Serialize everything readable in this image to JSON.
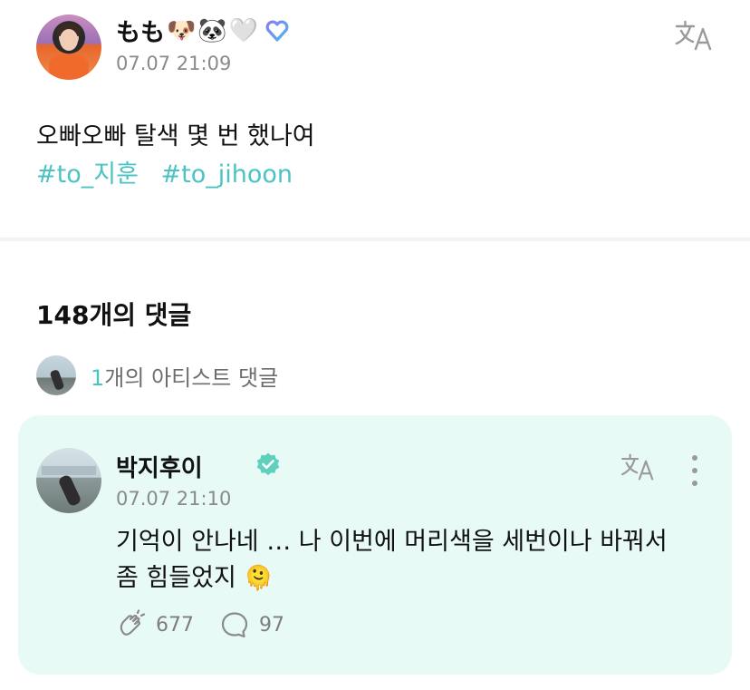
{
  "post": {
    "author_name": "もも",
    "author_emojis": [
      "🐶",
      "🐼",
      "🤍"
    ],
    "timestamp": "07.07 21:09",
    "body": "오빠오빠 탈색 몇 번 했나여",
    "hashtags": [
      "#to_지훈",
      "#to_jihoon"
    ],
    "translate_icon": "translate-icon",
    "badge_icon": "weverse-heart-icon"
  },
  "comments_section": {
    "count_label": "148개의 댓글",
    "artist_comments": {
      "count": "1",
      "label": "개의 아티스트 댓글"
    }
  },
  "artist_comment": {
    "name": "박지후이",
    "verified_icon": "verified-check-icon",
    "timestamp": "07.07 21:10",
    "text_lines": [
      "기억이 안나네 … 나 이번에 머리색을 세번이나 바꿔서",
      "좀 힘들었지"
    ],
    "emoji": "🫠",
    "likes": "677",
    "replies": "97",
    "like_icon": "applause-icon",
    "reply_icon": "comment-bubble-icon",
    "more_icon": "more-vertical-icon"
  },
  "colors": {
    "accent": "#4cc3c3",
    "card_bg": "#e8faf6",
    "muted": "#8a8a8a",
    "verified": "#5fd0bd"
  }
}
